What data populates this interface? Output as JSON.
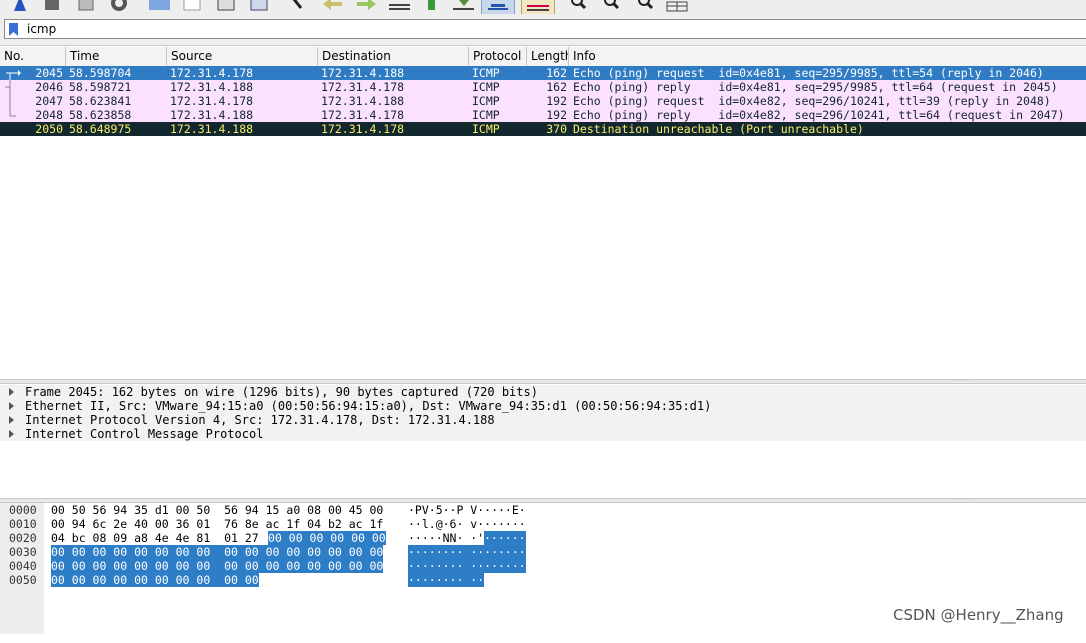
{
  "toolbar": {
    "icons": [
      "shark-fin-start-icon",
      "stop-capture-icon",
      "restart-capture-icon",
      "capture-options-icon",
      "open-file-icon",
      "save-file-icon",
      "close-file-icon",
      "reload-icon",
      "find-packet-icon",
      "go-back-icon",
      "go-forward-icon",
      "go-to-packet-icon",
      "first-packet-icon",
      "last-packet-icon",
      "auto-scroll-icon",
      "colorize-icon",
      "zoom-in-icon",
      "zoom-out-icon",
      "normal-size-icon",
      "resize-columns-icon"
    ]
  },
  "filter": {
    "value": "icmp"
  },
  "packet_list": {
    "columns": [
      "No.",
      "Time",
      "Source",
      "Destination",
      "Protocol",
      "Length",
      "Info"
    ],
    "rows": [
      {
        "no": "2045",
        "time": "58.598704",
        "source": "172.31.4.178",
        "destination": "172.31.4.188",
        "protocol": "ICMP",
        "length": "162",
        "info": "Echo (ping) request  id=0x4e81, seq=295/9985, ttl=54 (reply in 2046)",
        "style": "selected"
      },
      {
        "no": "2046",
        "time": "58.598721",
        "source": "172.31.4.188",
        "destination": "172.31.4.178",
        "protocol": "ICMP",
        "length": "162",
        "info": "Echo (ping) reply    id=0x4e81, seq=295/9985, ttl=64 (request in 2045)",
        "style": "pink"
      },
      {
        "no": "2047",
        "time": "58.623841",
        "source": "172.31.4.178",
        "destination": "172.31.4.188",
        "protocol": "ICMP",
        "length": "192",
        "info": "Echo (ping) request  id=0x4e82, seq=296/10241, ttl=39 (reply in 2048)",
        "style": "pink"
      },
      {
        "no": "2048",
        "time": "58.623858",
        "source": "172.31.4.188",
        "destination": "172.31.4.178",
        "protocol": "ICMP",
        "length": "192",
        "info": "Echo (ping) reply    id=0x4e82, seq=296/10241, ttl=64 (request in 2047)",
        "style": "pink"
      },
      {
        "no": "2050",
        "time": "58.648975",
        "source": "172.31.4.188",
        "destination": "172.31.4.178",
        "protocol": "ICMP",
        "length": "370",
        "info": "Destination unreachable (Port unreachable)",
        "style": "error"
      }
    ]
  },
  "details": {
    "items": [
      "Frame 2045: 162 bytes on wire (1296 bits), 90 bytes captured (720 bits)",
      "Ethernet II, Src: VMware_94:15:a0 (00:50:56:94:15:a0), Dst: VMware_94:35:d1 (00:50:56:94:35:d1)",
      "Internet Protocol Version 4, Src: 172.31.4.178, Dst: 172.31.4.188",
      "Internet Control Message Protocol"
    ]
  },
  "bytes": {
    "rows": [
      {
        "offset": "0000",
        "hex_plain": "00 50 56 94 35 d1 00 50  56 94 15 a0 08 00 45 00",
        "hex_hl": "",
        "ascii_plain": "·PV·5··P V·····E·",
        "ascii_hl": ""
      },
      {
        "offset": "0010",
        "hex_plain": "00 94 6c 2e 40 00 36 01  76 8e ac 1f 04 b2 ac 1f",
        "hex_hl": "",
        "ascii_plain": "··l.@·6· v·······",
        "ascii_hl": ""
      },
      {
        "offset": "0020",
        "hex_plain": "04 bc 08 09 a8 4e 4e 81  01 27 ",
        "hex_hl": "00 00 00 00 00 00",
        "ascii_plain": "·····NN· ·'",
        "ascii_hl": "······"
      },
      {
        "offset": "0030",
        "hex_plain": "",
        "hex_hl": "00 00 00 00 00 00 00 00  00 00 00 00 00 00 00 00",
        "ascii_plain": "",
        "ascii_hl": "········ ········"
      },
      {
        "offset": "0040",
        "hex_plain": "",
        "hex_hl": "00 00 00 00 00 00 00 00  00 00 00 00 00 00 00 00",
        "ascii_plain": "",
        "ascii_hl": "········ ········"
      },
      {
        "offset": "0050",
        "hex_plain": "",
        "hex_hl": "00 00 00 00 00 00 00 00  00 00",
        "ascii_plain": "",
        "ascii_hl": "········ ··"
      }
    ]
  },
  "watermark": "CSDN @Henry__Zhang",
  "colors": {
    "selected_bg": "#2f7cc4",
    "pink_bg": "#fce0ff",
    "error_bg": "#12272e",
    "error_fg": "#f7ee6a",
    "hex_highlight": "#2e7ec7"
  }
}
